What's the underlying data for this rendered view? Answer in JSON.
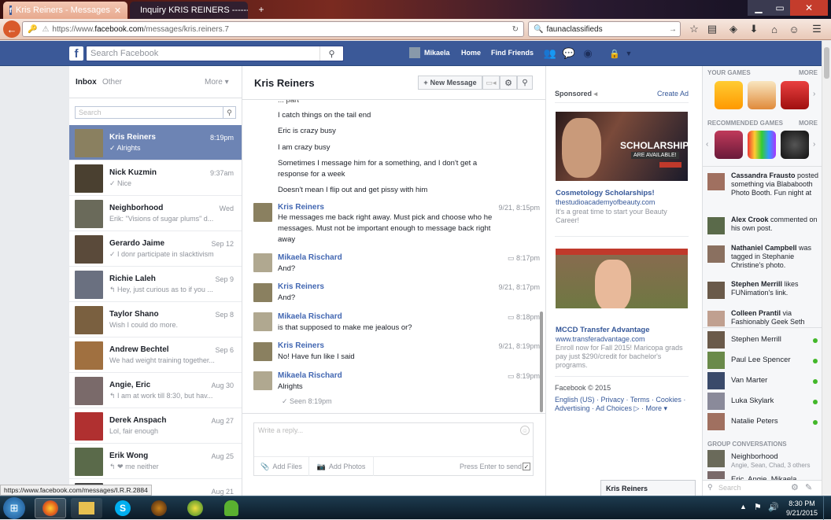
{
  "browser": {
    "tabs": [
      {
        "label": "Kris Reiners - Messages",
        "active": true
      },
      {
        "label": "Inquiry KRIS REINERS -------...",
        "active": false
      }
    ],
    "new_tab": "+",
    "url_prefix": "https://www.",
    "url_domain": "facebook.com",
    "url_path": "/messages/kris.reiners.7",
    "search_text": "faunaclassifieds",
    "status_url": "https://www.facebook.com/messages/I.R.R.2884"
  },
  "fb": {
    "search_placeholder": "Search Facebook",
    "user_name": "Mikaela",
    "home": "Home",
    "find_friends": "Find Friends"
  },
  "inbox": {
    "inbox_label": "Inbox",
    "other_label": "Other",
    "more_label": "More",
    "search_placeholder": "Search",
    "threads": [
      {
        "name": "Kris Reiners",
        "preview": "✓ Alrights",
        "time": "8:19pm",
        "color": "#8a8060"
      },
      {
        "name": "Nick Kuzmin",
        "preview": "✓ Nice",
        "time": "9:37am",
        "color": "#4a4030"
      },
      {
        "name": "Neighborhood",
        "preview": "Erik: \"Visions of sugar plums\" d...",
        "time": "Wed",
        "color": "#6a6a5a"
      },
      {
        "name": "Gerardo Jaime",
        "preview": "✓ I donr participate in slacktivism",
        "time": "Sep 12",
        "color": "#5a4a3a"
      },
      {
        "name": "Richie Laleh",
        "preview": "↰ Hey, just curious as to if you ...",
        "time": "Sep 9",
        "color": "#6a7080"
      },
      {
        "name": "Taylor Shano",
        "preview": "Wish I could do more.",
        "time": "Sep 8",
        "color": "#7a6040"
      },
      {
        "name": "Andrew Bechtel",
        "preview": "We had weight training together...",
        "time": "Sep 6",
        "color": "#a07040"
      },
      {
        "name": "Angie, Eric",
        "preview": "↰ I am at work till 8:30, but hav...",
        "time": "Aug 30",
        "color": "#7a6a6a"
      },
      {
        "name": "Derek Anspach",
        "preview": "Lol, fair enough",
        "time": "Aug 27",
        "color": "#b03030"
      },
      {
        "name": "Erik Wong",
        "preview": "↰ ❤ me neither",
        "time": "Aug 25",
        "color": "#5a6a4a"
      },
      {
        "name": "",
        "preview": "",
        "time": "Aug 21",
        "color": "#444444"
      }
    ]
  },
  "conversation": {
    "title": "Kris Reiners",
    "new_message": "New Message",
    "messages": [
      {
        "type": "text",
        "text": "I catch things on the tail end"
      },
      {
        "type": "text",
        "text": "Eric is crazy busy"
      },
      {
        "type": "text",
        "text": "I am crazy busy"
      },
      {
        "type": "text",
        "text": "Sometimes I message him for a something, and I don't get a response for a week"
      },
      {
        "type": "text",
        "text": "Doesn't mean I flip out and get pissy with him"
      }
    ],
    "blocks": [
      {
        "sender": "Kris Reiners",
        "time": "9/21, 8:15pm",
        "text": "He messages me back right away. Must pick and choose who he messages. Must not be important enough to message back right away"
      },
      {
        "sender": "Mikaela Rischard",
        "time": "8:17pm",
        "text": "And?"
      },
      {
        "sender": "Kris Reiners",
        "time": "9/21, 8:17pm",
        "text": "And?"
      },
      {
        "sender": "Mikaela Rischard",
        "time": "8:18pm",
        "text": "is that supposed to make me jealous or?"
      },
      {
        "sender": "Kris Reiners",
        "time": "9/21, 8:19pm",
        "text": "No! Have fun like I said"
      },
      {
        "sender": "Mikaela Rischard",
        "time": "8:19pm",
        "text": "Alrights"
      }
    ],
    "seen": "✓ Seen 8:19pm",
    "reply_placeholder": "Write a reply...",
    "add_files": "Add Files",
    "add_photos": "Add Photos",
    "press_enter": "Press Enter to send"
  },
  "ads": {
    "sponsored": "Sponsored",
    "create_ad": "Create Ad",
    "ad1_banner_line1": "SCHOLARSHIPS",
    "ad1_banner_line2": "ARE AVAILABLE!",
    "ad1_title": "Cosmetology Scholarships!",
    "ad1_link": "thestudioacademyofbeauty.com",
    "ad1_text": "It's a great time to start your Beauty Career!",
    "ad2_title": "MCCD Transfer Advantage",
    "ad2_link": "www.transferadvantage.com",
    "ad2_text": "Enroll now for Fall 2015! Maricopa grads pay just $290/credit for bachelor's programs.",
    "footer_copy": "Facebook © 2015",
    "footer_links1": "English (US) · Privacy · Terms · Cookies ·",
    "footer_links2": "Advertising · Ad Choices ▷ · More ▾"
  },
  "chat": {
    "your_games": "YOUR GAMES",
    "recommended_games": "RECOMMENDED GAMES",
    "more": "MORE",
    "activities": [
      {
        "name": "Cassandra Frausto",
        "text": " posted something via Blababooth Photo Booth. Fun night at the mall"
      },
      {
        "name": "Alex Crook",
        "text": " commented on his own post."
      },
      {
        "name": "Nathaniel Campbell",
        "text": " was tagged in Stephanie Christine's photo."
      },
      {
        "name": "Stephen Merrill",
        "text": " likes FUNimation's link."
      },
      {
        "name": "Colleen Prantil",
        "text": " via Fashionably Geek Seth"
      }
    ],
    "friends": [
      "Stephen Merrill",
      "Paul Lee Spencer",
      "Van Marter",
      "Luka Skylark",
      "Natalie Peters"
    ],
    "group_conversations": "GROUP CONVERSATIONS",
    "group_name": "Neighborhood",
    "group_members": "Angie, Sean, Chad, 3 others",
    "group2_name": "Eric, Angie, Mikaela",
    "search_placeholder": "Search",
    "open_chat": "Kris Reiners"
  },
  "taskbar": {
    "time": "8:30 PM",
    "date": "9/21/2015"
  }
}
